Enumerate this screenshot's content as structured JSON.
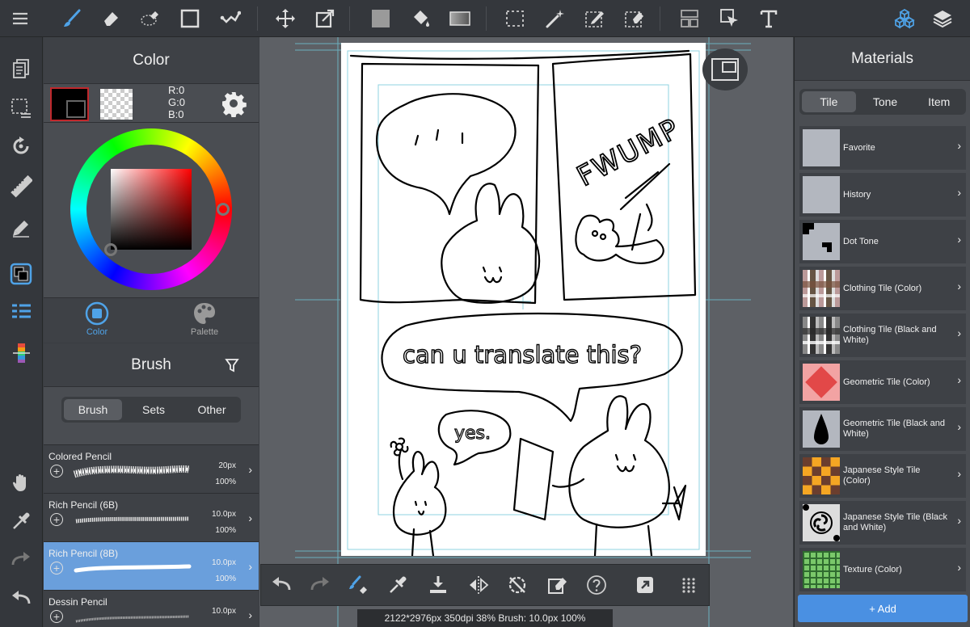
{
  "color_panel": {
    "title": "Color",
    "rgb": {
      "r": "R:0",
      "g": "G:0",
      "b": "B:0"
    },
    "tabs": [
      {
        "label": "Color",
        "active": true
      },
      {
        "label": "Palette",
        "active": false
      }
    ]
  },
  "brush_panel": {
    "title": "Brush",
    "tabs": [
      {
        "label": "Brush",
        "active": true
      },
      {
        "label": "Sets",
        "active": false
      },
      {
        "label": "Other",
        "active": false
      }
    ],
    "brushes": [
      {
        "name": "Colored Pencil",
        "size": "20px",
        "opacity": "100%",
        "selected": false
      },
      {
        "name": "Rich Pencil (6B)",
        "size": "10.0px",
        "opacity": "100%",
        "selected": false
      },
      {
        "name": "Rich Pencil (8B)",
        "size": "10.0px",
        "opacity": "100%",
        "selected": true
      },
      {
        "name": "Dessin Pencil",
        "size": "10.0px",
        "opacity": "",
        "selected": false
      }
    ]
  },
  "canvas": {
    "status": "2122*2976px 350dpi 38% Brush: 10.0px 100%",
    "comic_text": {
      "fwump": "FWUMP",
      "question": "can u translate this?",
      "answer": "yes."
    }
  },
  "materials": {
    "title": "Materials",
    "tabs": [
      {
        "label": "Tile",
        "active": true
      },
      {
        "label": "Tone",
        "active": false
      },
      {
        "label": "Item",
        "active": false
      }
    ],
    "items": [
      {
        "label": "Favorite"
      },
      {
        "label": "History"
      },
      {
        "label": "Dot Tone"
      },
      {
        "label": "Clothing Tile (Color)"
      },
      {
        "label": "Clothing Tile (Black and White)"
      },
      {
        "label": "Geometric Tile (Color)"
      },
      {
        "label": "Geometric Tile (Black and White)"
      },
      {
        "label": "Japanese Style Tile (Color)"
      },
      {
        "label": "Japanese Style Tile (Black and White)"
      },
      {
        "label": "Texture (Color)"
      }
    ],
    "add_label": "+ Add"
  },
  "colors": {
    "accent": "#4a90e2",
    "selected_row": "#6a9fdc",
    "panel_bg": "#4a4d52",
    "toolbar_bg": "#34373c"
  }
}
